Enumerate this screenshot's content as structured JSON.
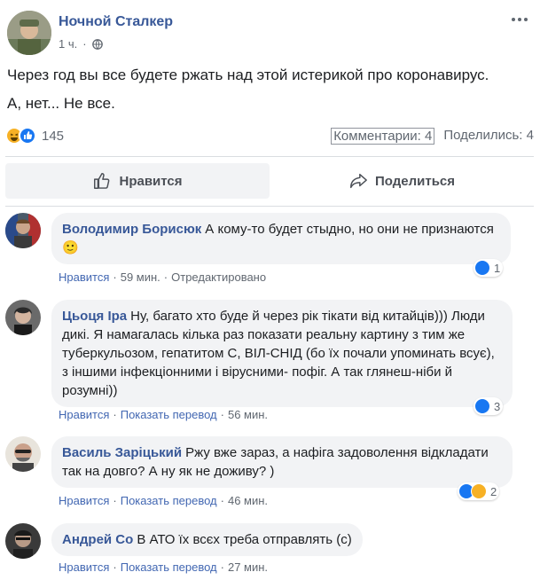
{
  "post": {
    "author": "Ночной Сталкер",
    "time": "1 ч.",
    "text_line_1": "Через год вы все будете ржать над этой истерикой про коронавирус.",
    "text_line_2": "А, нет... Не все.",
    "reaction_count": "145",
    "comments_link": "Комментарии: 4",
    "shares_link": "Поделились: 4"
  },
  "actions": {
    "like_label": "Нравится",
    "share_label": "Поделиться"
  },
  "comments": [
    {
      "author": "Володимир Борисюк",
      "text": "А кому-то будет стыдно, но они не признаются 🙂",
      "like_label": "Нравится",
      "time": "59 мин.",
      "edited": "Отредактировано",
      "reaction_count": "1"
    },
    {
      "author": "Цьоця Іра",
      "text": "Ну, багато хто буде й через рік тікати від китайців))) Люди дикі. Я намагалась кілька раз показати реальну картину з тим же туберкульозом, гепатитом С, ВІЛ-СНІД (бо їх почали упоминать всує), з іншими інфекціонними і вірусними- пофіг. А так глянеш-ніби й розумні))",
      "like_label": "Нравится",
      "translate_label": "Показать перевод",
      "time": "56 мин.",
      "reaction_count": "3"
    },
    {
      "author": "Василь Заріцький",
      "text": "Ржу вже зараз, а нафіга задоволення відкладати так на довго? А ну як не доживу? )",
      "like_label": "Нравится",
      "translate_label": "Показать перевод",
      "time": "46 мин.",
      "reaction_count": "2"
    },
    {
      "author": "Андрей Со",
      "text": "В АТО їх всєх треба отправлять (с)",
      "like_label": "Нравится",
      "translate_label": "Показать перевод",
      "time": "27 мин."
    }
  ],
  "colors": {
    "link_blue": "#385898",
    "like_blue": "#1877f2",
    "haha_yellow": "#f7b125",
    "bubble_gray": "#f2f3f5"
  }
}
